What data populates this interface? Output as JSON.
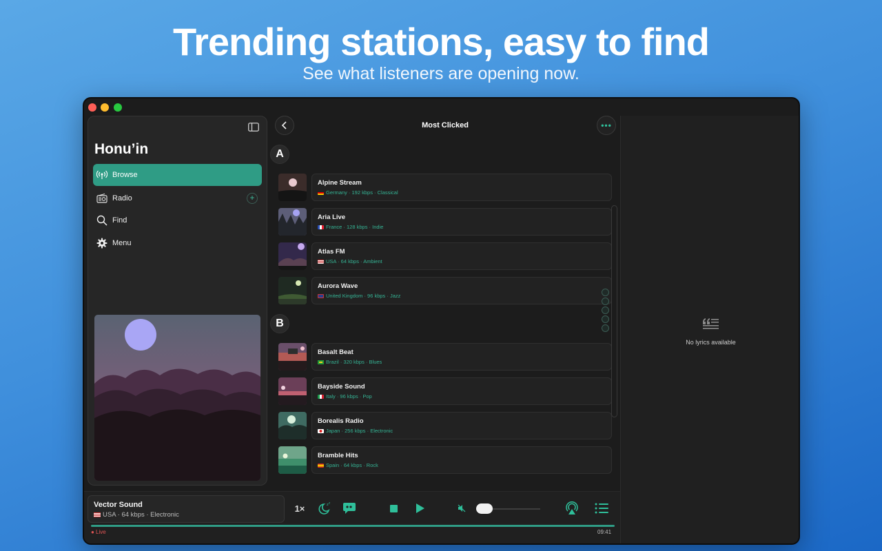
{
  "hero": {
    "title": "Trending stations, easy to find",
    "subtitle": "See what listeners are opening now."
  },
  "sidebar": {
    "app_title": "Honu’in",
    "items": [
      {
        "label": "Browse",
        "icon": "broadcast-icon",
        "active": true
      },
      {
        "label": "Radio",
        "icon": "radio-icon"
      },
      {
        "label": "Find",
        "icon": "search-icon"
      },
      {
        "label": "Menu",
        "icon": "gear-icon"
      }
    ],
    "add_label": "+"
  },
  "main": {
    "title": "Most Clicked",
    "more_label": "•••",
    "sections": [
      {
        "letter": "A",
        "stations": [
          {
            "name": "Alpine Stream",
            "meta": "Germany · 192 kbps · Classical"
          },
          {
            "name": "Aria Live",
            "meta": "France · 128 kbps · Indie"
          },
          {
            "name": "Atlas FM",
            "meta": "USA · 64 kbps · Ambient"
          },
          {
            "name": "Aurora Wave",
            "meta": "United Kingdom · 96 kbps · Jazz"
          }
        ]
      },
      {
        "letter": "B",
        "stations": [
          {
            "name": "Basalt Beat",
            "meta": "Brazil · 320 kbps · Blues"
          },
          {
            "name": "Bayside Sound",
            "meta": "Italy · 96 kbps · Pop"
          },
          {
            "name": "Borealis Radio",
            "meta": "Japan · 256 kbps · Electronic"
          },
          {
            "name": "Bramble Hits",
            "meta": "Spain · 64 kbps · Rock"
          }
        ]
      }
    ]
  },
  "lyrics": {
    "empty_label": "No lyrics available"
  },
  "player": {
    "now_playing_title": "Vector Sound",
    "now_playing_meta": "USA · 64 kbps · Electronic",
    "speed_label": "1×",
    "live_label": "● Live",
    "elapsed": "09:41",
    "volume": 0.12
  },
  "colors": {
    "accent": "#2f9c85",
    "accent_text": "#35b394",
    "live": "#e05555"
  }
}
